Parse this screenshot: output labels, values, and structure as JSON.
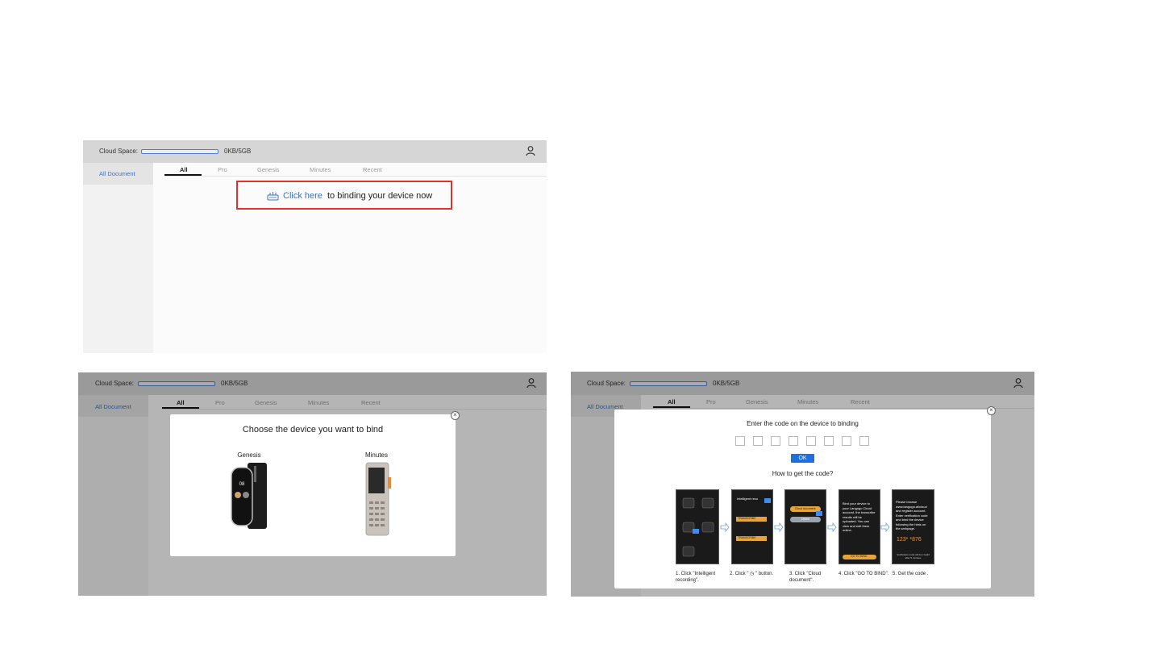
{
  "cloud": {
    "label": "Cloud Space:",
    "size": "0KB/5GB"
  },
  "sidebar": {
    "all_document": "All Document"
  },
  "tabs": [
    "All",
    "Pro",
    "Genesis",
    "Minutes",
    "Recent"
  ],
  "bind_prompt": {
    "link": "Click here",
    "rest": "to binding your device now"
  },
  "choose_modal": {
    "title": "Choose the device you want to bind",
    "devices": [
      {
        "name": "Genesis"
      },
      {
        "name": "Minutes"
      }
    ]
  },
  "code_modal": {
    "title": "Enter the code on the device to binding",
    "ok_label": "OK",
    "how_to": "How to get the code?",
    "steps": [
      {
        "caption_1": "1. Click \"Intelligent",
        "caption_2": "recording\"."
      },
      {
        "caption_1": "2. Click \" ◷ \" button.",
        "caption_2": ""
      },
      {
        "caption_1": "3. Click \"Cloud",
        "caption_2": "document\"."
      },
      {
        "caption_1": "4. Click \"GO TO BIND\".",
        "caption_2": ""
      },
      {
        "caption_1": "5. Get the code .",
        "caption_2": ""
      }
    ],
    "phone_texts": {
      "p2_header": "Intelligent reco",
      "p2_badge": "TRANSCRIBE",
      "p3_btn1": "Cloud document",
      "p3_btn2": "Delete",
      "p4_text": "Bind your device to your Langogo Cloud account, the transcribe results will be uploaded. You can view and edit them online.",
      "p4_btn": "GO TO BIND",
      "p5_text": "Please browse www.langogo.ai/cloud and register account. Enter verification code and bind the device following the hints on the webpage.",
      "p5_code": "123* *876",
      "p5_note": "Verification code will be invalid after 5 minutes"
    }
  },
  "colors": {
    "accent": "#1f6fe0",
    "link": "#3b72c4",
    "highlight_border": "#e03131"
  }
}
